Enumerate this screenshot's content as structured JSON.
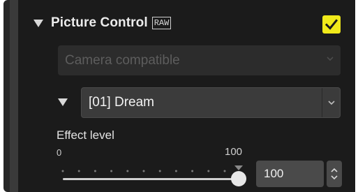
{
  "section": {
    "title": "Picture Control",
    "badge": "RAW",
    "enabled": true
  },
  "compat_select": {
    "value": "Camera compatible",
    "disabled": true
  },
  "picture_control_select": {
    "value": "[01] Dream"
  },
  "effect_level": {
    "label": "Effect level",
    "min_label": "0",
    "max_label": "100",
    "value": "100",
    "fraction": 1.0
  },
  "colors": {
    "checkbox": "#f1ea1a",
    "panel": "#1b1b1b"
  },
  "icons": {
    "collapse": "triangle-down-icon",
    "check": "checkmark-icon",
    "dropdown": "chevron-down-icon",
    "spin": "spin-arrows-icon"
  }
}
